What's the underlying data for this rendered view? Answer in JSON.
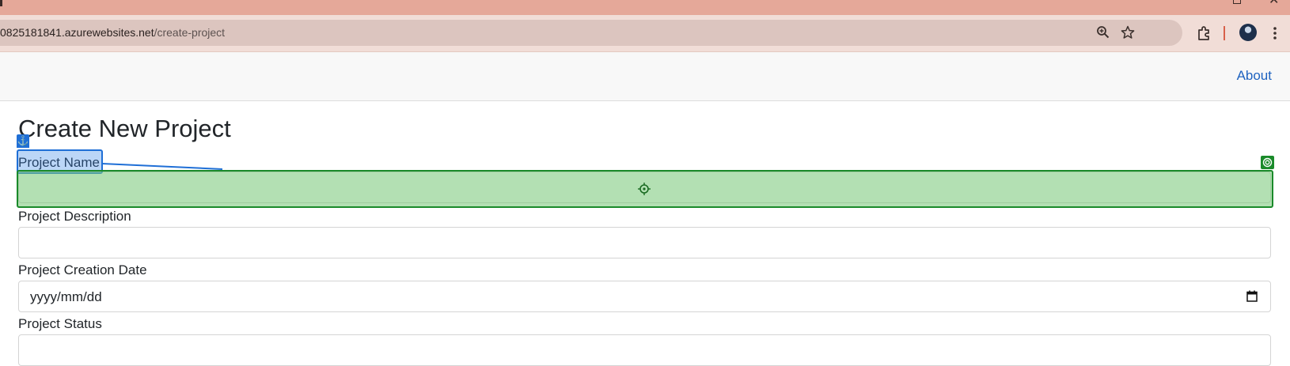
{
  "browser": {
    "url_host": "0825181841.azurewebsites.net",
    "url_path": "/create-project",
    "icons": [
      "zoom-icon",
      "bookmark-star-icon",
      "extensions-icon",
      "profile-avatar",
      "kebab-menu-icon"
    ]
  },
  "nav": {
    "about_label": "About"
  },
  "form": {
    "title": "Create New Project",
    "fields": [
      {
        "label": "Project Name",
        "value": ""
      },
      {
        "label": "Project Description",
        "value": ""
      },
      {
        "label": "Project Creation Date",
        "value": "yyyy/mm/dd"
      },
      {
        "label": "Project Status",
        "value": ""
      }
    ]
  },
  "colors": {
    "titlebar": "#e5a899",
    "toolbar": "#f1ddd7",
    "link": "#1f63c0",
    "selection_label": "#1f6fd6",
    "selection_input": "#1a8a2a"
  }
}
